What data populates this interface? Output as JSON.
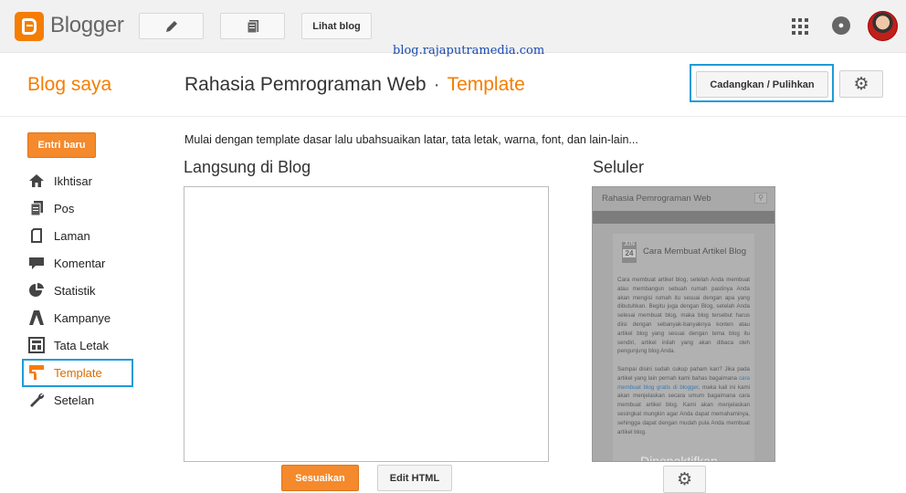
{
  "app": {
    "brand": "Blogger",
    "view_blog_label": "Lihat blog",
    "watermark": "blog.rajaputramedia.com"
  },
  "header": {
    "my_blogs": "Blog saya",
    "blog_title": "Rahasia Pemrograman Web",
    "separator": "·",
    "page_title": "Template",
    "backup_label": "Cadangkan / Pulihkan"
  },
  "sidebar": {
    "new_post_label": "Entri baru",
    "items": [
      {
        "label": "Ikhtisar",
        "icon": "home-icon"
      },
      {
        "label": "Pos",
        "icon": "posts-icon"
      },
      {
        "label": "Laman",
        "icon": "page-icon"
      },
      {
        "label": "Komentar",
        "icon": "comment-icon"
      },
      {
        "label": "Statistik",
        "icon": "pie-chart-icon"
      },
      {
        "label": "Kampanye",
        "icon": "campaign-icon"
      },
      {
        "label": "Tata Letak",
        "icon": "layout-icon"
      },
      {
        "label": "Template",
        "icon": "template-icon",
        "active": true
      },
      {
        "label": "Setelan",
        "icon": "wrench-icon"
      }
    ]
  },
  "main": {
    "intro": "Mulai dengan template dasar lalu ubahsuaikan latar, tata letak, warna, font, dan lain-lain...",
    "live_title": "Langsung di Blog",
    "mobile_title": "Seluler",
    "customize_label": "Sesuaikan",
    "edit_html_label": "Edit HTML"
  },
  "mobile_preview": {
    "blog_name": "Rahasia Pemrograman Web",
    "date_month": "JUN",
    "date_day": "24",
    "post_title": "Cara Membuat Artikel Blog",
    "para1": "Cara membuat artikel blog, setelah Anda membuat atau membangun sebuah rumah pastinya Anda akan mengisi rumah itu sesuai dengan apa yang dibutuhkan. Begitu juga dengan Blog, setelah Anda selesai membuat blog, maka blog tersebut harus diisi dengan sebanyak-banyaknya konten atau artikel blog yang sesuai dengan tema blog itu sendiri, artikel inilah yang akan dibaca oleh pengunjung blog Anda.",
    "para2_a": "Sampai disini sudah cukup paham kan? Jika pada artikel yang lain pernah kami bahas bagaimana",
    "para2_link": "cara membuat blog gratis di blogger",
    "para2_b": ", maka kali ini kami akan menjelaskan secara umum bagaimana cara membuat artikel blog. Kami akan menjelaskan sesingkat mungkin agar Anda dapat memahaminya, sehingga dapat dengan mudah pula Anda membuat artikel blog.",
    "overlay": "Dinonaktifkan"
  },
  "colors": {
    "brand_orange": "#f57d00",
    "highlight_blue": "#1e9bd7"
  }
}
